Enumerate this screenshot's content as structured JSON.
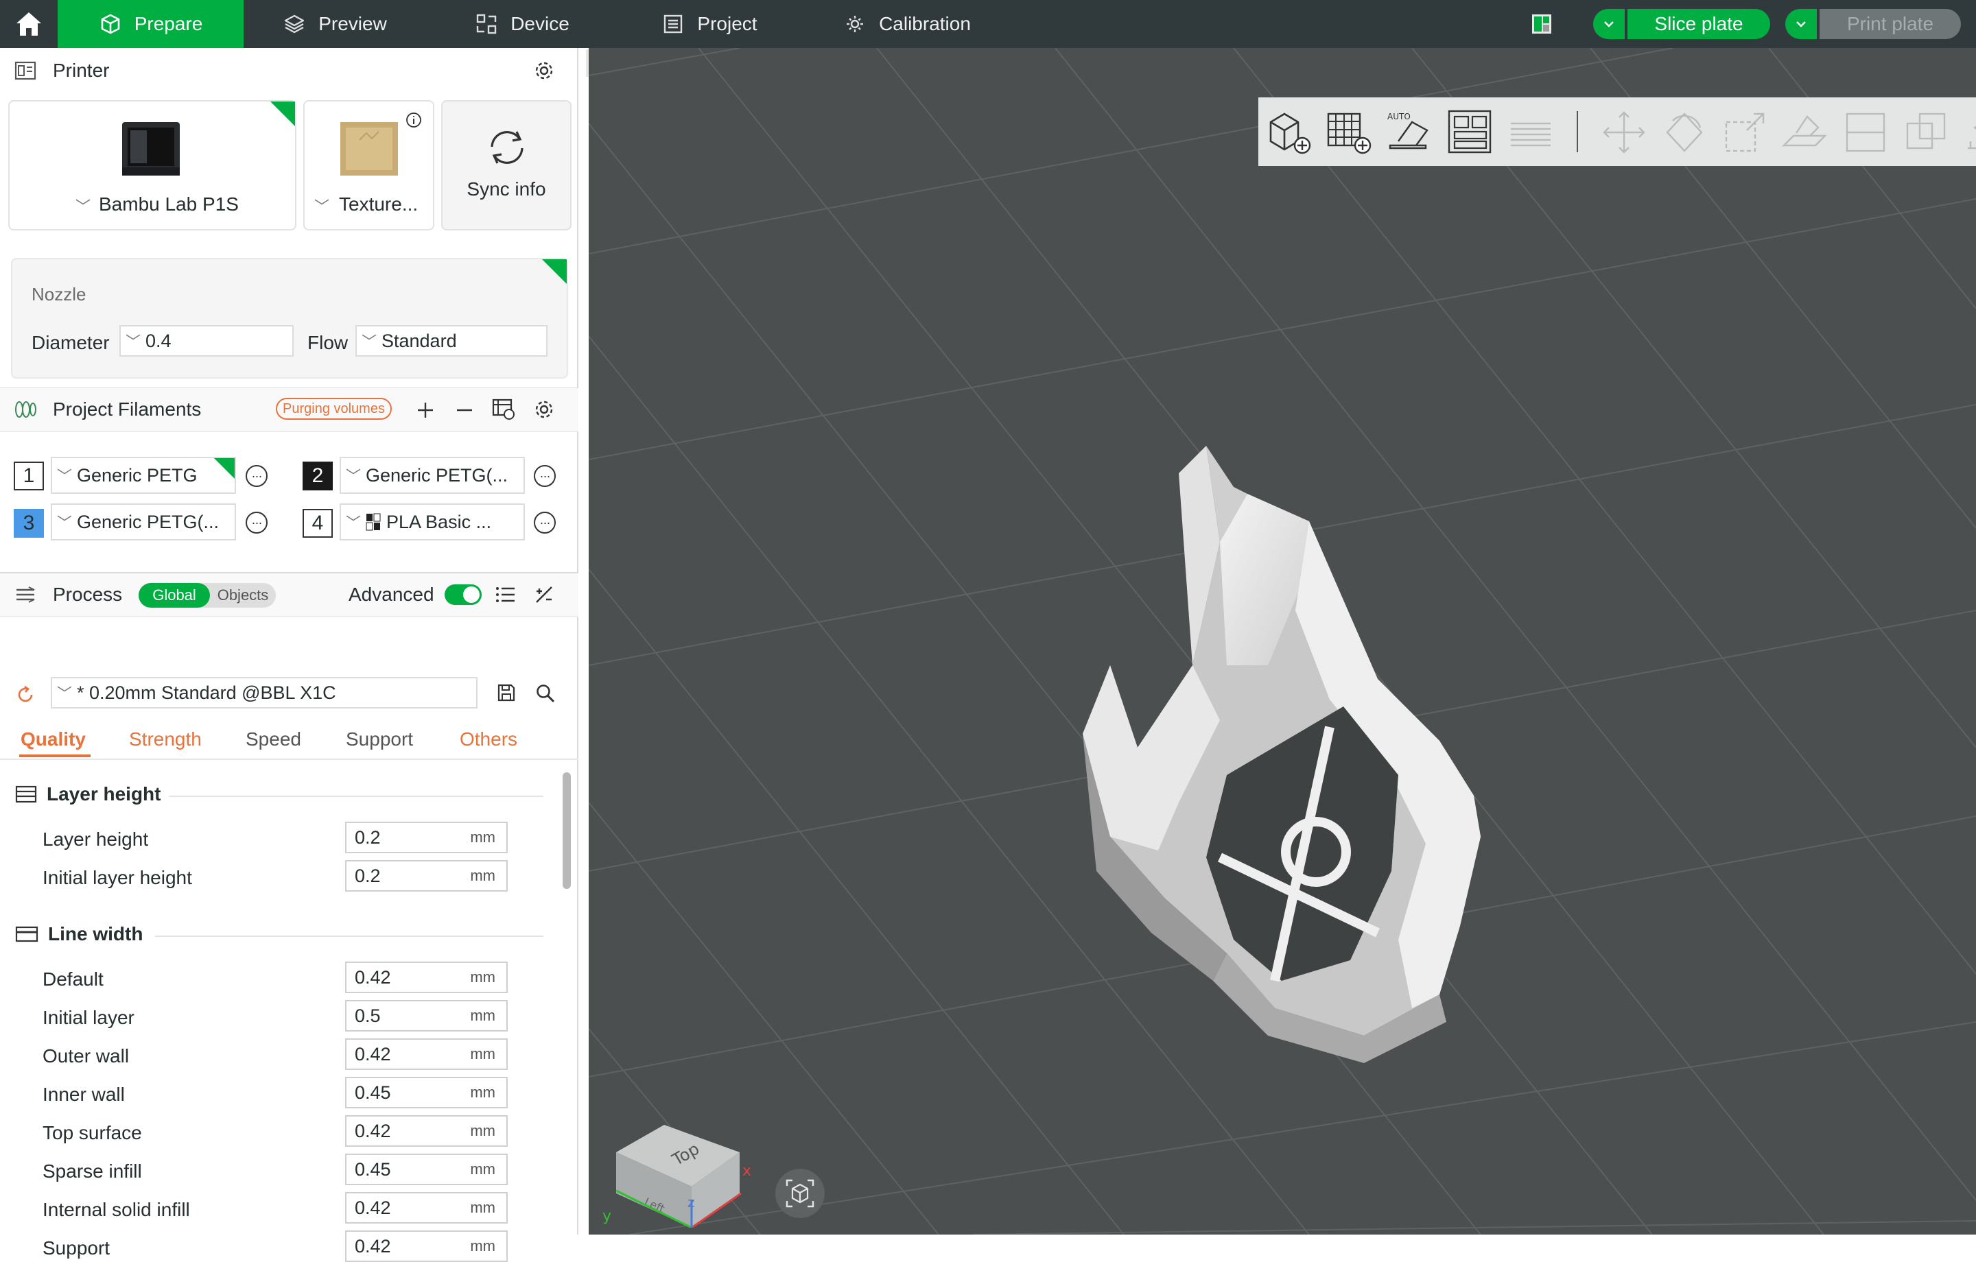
{
  "topbar": {
    "tabs": [
      {
        "label": "Prepare",
        "icon": "cube-icon",
        "active": true
      },
      {
        "label": "Preview",
        "icon": "layers-icon",
        "active": false
      },
      {
        "label": "Device",
        "icon": "device-icon",
        "active": false
      },
      {
        "label": "Project",
        "icon": "project-icon",
        "active": false
      },
      {
        "label": "Calibration",
        "icon": "calibration-icon",
        "active": false
      }
    ],
    "slice_label": "Slice plate",
    "print_label": "Print plate"
  },
  "printer": {
    "title": "Printer",
    "printer_name": "Bambu Lab P1S",
    "plate_name": "Texture...",
    "sync_label": "Sync info"
  },
  "nozzle": {
    "title": "Nozzle",
    "diameter_label": "Diameter",
    "diameter_value": "0.4",
    "flow_label": "Flow",
    "flow_value": "Standard"
  },
  "filaments": {
    "title": "Project Filaments",
    "purging_label": "Purging volumes",
    "items": [
      {
        "index": "1",
        "name": "Generic PETG",
        "color": "#ffffff"
      },
      {
        "index": "2",
        "name": "Generic PETG(...",
        "color": "#1a1a1a"
      },
      {
        "index": "3",
        "name": "Generic PETG(...",
        "color": "#4a9ae8"
      },
      {
        "index": "4",
        "name": "PLA Basic ...",
        "color": "#ffffff"
      }
    ]
  },
  "process": {
    "title": "Process",
    "global_label": "Global",
    "objects_label": "Objects",
    "advanced_label": "Advanced",
    "advanced_on": true,
    "preset": "* 0.20mm Standard @BBL X1C",
    "tabs": [
      "Quality",
      "Strength",
      "Speed",
      "Support",
      "Others"
    ],
    "active_tab": "Quality"
  },
  "quality": {
    "unit": "mm",
    "layer_height_group": "Layer height",
    "layer_height_rows": [
      {
        "label": "Layer height",
        "value": "0.2"
      },
      {
        "label": "Initial layer height",
        "value": "0.2"
      }
    ],
    "line_width_group": "Line width",
    "line_width_rows": [
      {
        "label": "Default",
        "value": "0.42"
      },
      {
        "label": "Initial layer",
        "value": "0.5"
      },
      {
        "label": "Outer wall",
        "value": "0.42"
      },
      {
        "label": "Inner wall",
        "value": "0.45"
      },
      {
        "label": "Top surface",
        "value": "0.42"
      },
      {
        "label": "Sparse infill",
        "value": "0.45"
      },
      {
        "label": "Internal solid infill",
        "value": "0.42"
      },
      {
        "label": "Support",
        "value": "0.42"
      }
    ]
  },
  "viewcube": {
    "top_label": "Top",
    "left_label": "Left",
    "x_axis": "x",
    "y_axis": "y",
    "z_axis": "z"
  },
  "toolbar_icons": [
    "add-object-icon",
    "add-plate-icon",
    "auto-orient-icon",
    "arrange-icon",
    "layers-stack-icon",
    "move-icon",
    "rotate-icon",
    "scale-icon",
    "lay-on-face-icon",
    "cut-icon",
    "boolean-icon",
    "support-paint-icon",
    "seam-paint-icon",
    "text-icon",
    "emboss-icon",
    "measure-icon",
    "assembly-icon",
    "variable-height-icon",
    "more-icon",
    "split-icon"
  ],
  "colors": {
    "accent": "#00ae42",
    "topbar": "#303a3c",
    "viewport": "#4b4f50",
    "orange": "#e8733a"
  }
}
